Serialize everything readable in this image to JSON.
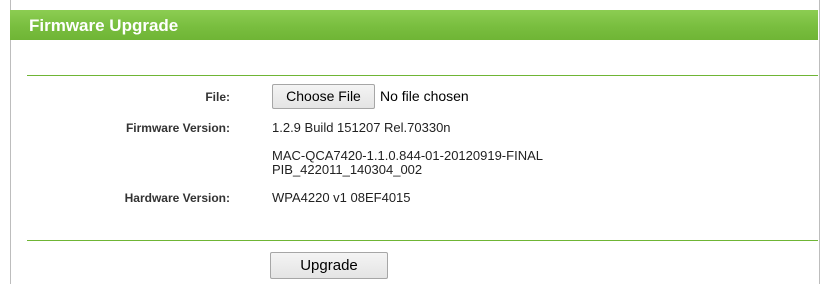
{
  "section": {
    "title": "Firmware Upgrade"
  },
  "file_row": {
    "label": "File:",
    "choose_button": "Choose File",
    "status": "No file chosen"
  },
  "firmware_row": {
    "label": "Firmware Version:",
    "value": "1.2.9 Build 151207 Rel.70330n"
  },
  "firmware_extra": {
    "line1": "MAC-QCA7420-1.1.0.844-01-20120919-FINAL",
    "line2": "PIB_422011_140304_002"
  },
  "hardware_row": {
    "label": "Hardware Version:",
    "value": "WPA4220 v1 08EF4015"
  },
  "actions": {
    "upgrade_button": "Upgrade"
  },
  "colors": {
    "accent": "#7bc142",
    "divider": "#6fb535"
  }
}
